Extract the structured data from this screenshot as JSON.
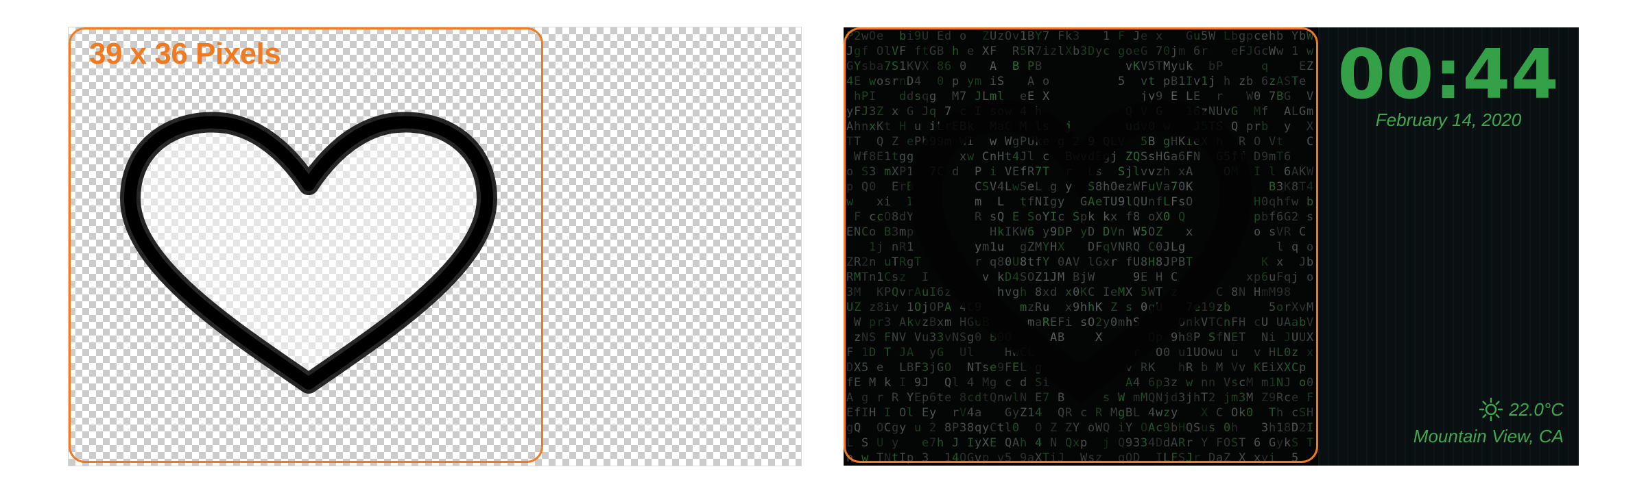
{
  "pixel_preview": {
    "size_label": "39 x 36 Pixels"
  },
  "clock_face": {
    "time": "00:44",
    "date": "February 14, 2020",
    "temperature": "22.0°C",
    "weather_icon": "sun-icon",
    "location": "Mountain View, CA"
  },
  "colors": {
    "accent_orange": "#f07a21",
    "clock_green": "#34a048",
    "matrix_green": "#2e8a3c",
    "heart_outline": "#111111"
  }
}
